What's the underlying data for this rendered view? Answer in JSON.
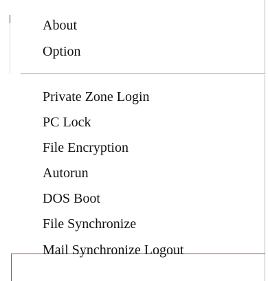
{
  "context_menu": {
    "group_1": [
      {
        "label": "About"
      },
      {
        "label": "Option"
      }
    ],
    "group_2": [
      {
        "label": "Private Zone Login"
      },
      {
        "label": "PC Lock"
      },
      {
        "label": "File Encryption"
      },
      {
        "label": "Autorun"
      },
      {
        "label": "DOS Boot"
      },
      {
        "label": "File Synchronize"
      },
      {
        "label": "Mail Synchronize Logout"
      }
    ],
    "highlight_color": "#e0363a"
  }
}
